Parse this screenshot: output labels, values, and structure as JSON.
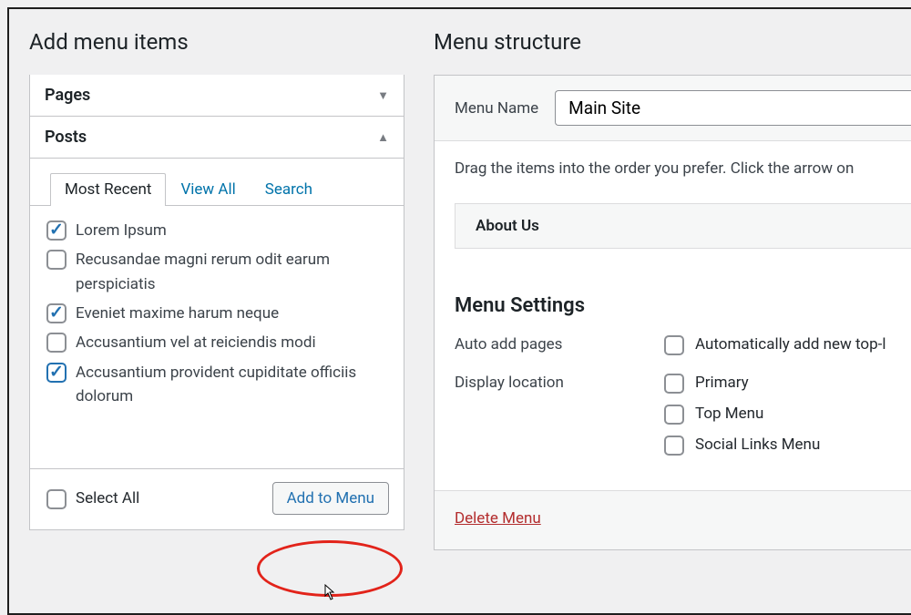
{
  "left": {
    "heading": "Add menu items",
    "boxes": {
      "pages_label": "Pages",
      "posts_label": "Posts"
    },
    "tabs": {
      "most_recent": "Most Recent",
      "view_all": "View All",
      "search": "Search"
    },
    "items": [
      {
        "label": "Lorem Ipsum",
        "checked": true,
        "emph": false
      },
      {
        "label": "Recusandae magni rerum odit earum perspiciatis",
        "checked": false,
        "emph": false
      },
      {
        "label": "Eveniet maxime harum neque",
        "checked": true,
        "emph": false
      },
      {
        "label": "Accusantium vel at reiciendis modi",
        "checked": false,
        "emph": false
      },
      {
        "label": "Accusantium provident cupiditate officiis dolorum",
        "checked": true,
        "emph": true
      }
    ],
    "select_all": "Select All",
    "add_button": "Add to Menu"
  },
  "right": {
    "heading": "Menu structure",
    "menu_name_label": "Menu Name",
    "menu_name_value": "Main Site",
    "drag_hint": "Drag the items into the order you prefer. Click the arrow on",
    "menu_items": [
      "About Us"
    ],
    "settings_heading": "Menu Settings",
    "auto_add_label": "Auto add pages",
    "auto_add_option": "Automatically add new top-l",
    "display_location_label": "Display location",
    "locations": [
      "Primary",
      "Top Menu",
      "Social Links Menu"
    ],
    "delete_menu": "Delete Menu"
  }
}
